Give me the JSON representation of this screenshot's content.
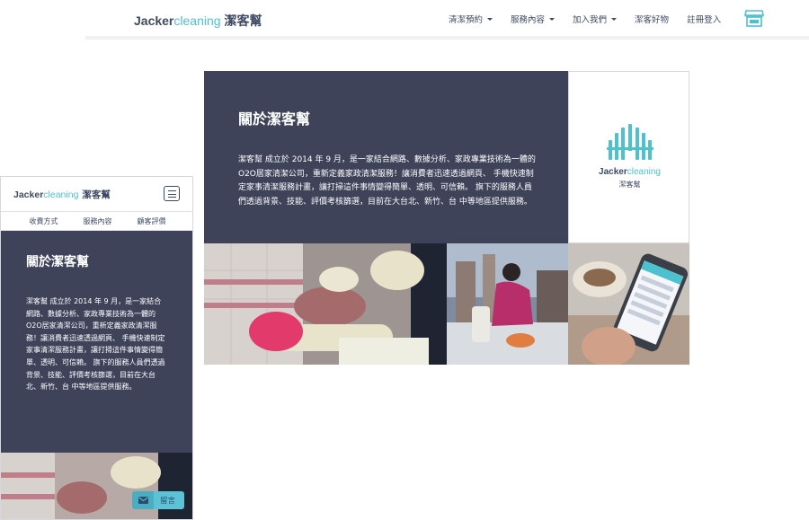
{
  "brand": {
    "name_en_1": "Jacker",
    "name_en_2": "cleaning",
    "name_zh": "潔客幫"
  },
  "desktop": {
    "nav": [
      {
        "label": "清潔預約",
        "dropdown": true
      },
      {
        "label": "服務內容",
        "dropdown": true
      },
      {
        "label": "加入我們",
        "dropdown": true
      },
      {
        "label": "潔客好物",
        "dropdown": false
      },
      {
        "label": "註冊登入",
        "dropdown": false
      }
    ],
    "store_icon": "store-icon",
    "about": {
      "title": "關於潔客幫",
      "body": "潔客幫 成立於 2014 年 9 月，是一家結合網路、數據分析、家政專業技術為一體的O2O居家清潔公司，重新定義家政清潔服務！讓消費者迅速透過網頁、 手機快速制定家事清潔服務計畫，讓打掃這件事情變得簡單、透明、可信賴。 旗下的服務人員們透過背景、技能、評價考核篩選，目前在大台北、新竹、台 中等地區提供服務。"
    },
    "logo_box": {
      "brand_en_1": "Jacker",
      "brand_en_2": "cleaning",
      "brand_zh": "潔客幫"
    }
  },
  "mobile": {
    "subnav": [
      "收費方式",
      "服務內容",
      "顧客評價"
    ],
    "about": {
      "title": "關於潔客幫",
      "body": "潔客幫 成立於 2014 年 9 月，是一家結合網路、數據分析、家政專業技術為一體的O2O居家清潔公司，重新定義家政清潔服務！讓消費者迅速透過網頁、 手機快速制定家事清潔服務計畫，讓打掃這件事情變得簡單、透明、可信賴。 旗下的服務人員們透過背景、技能、評價考核篩選，目前在大台北、新竹、台 中等地區提供服務。"
    },
    "message_button": "留言"
  },
  "colors": {
    "navy": "#3e435a",
    "teal": "#4ec1cf",
    "text": "#3e4a63",
    "message": "#5cc3d6"
  }
}
